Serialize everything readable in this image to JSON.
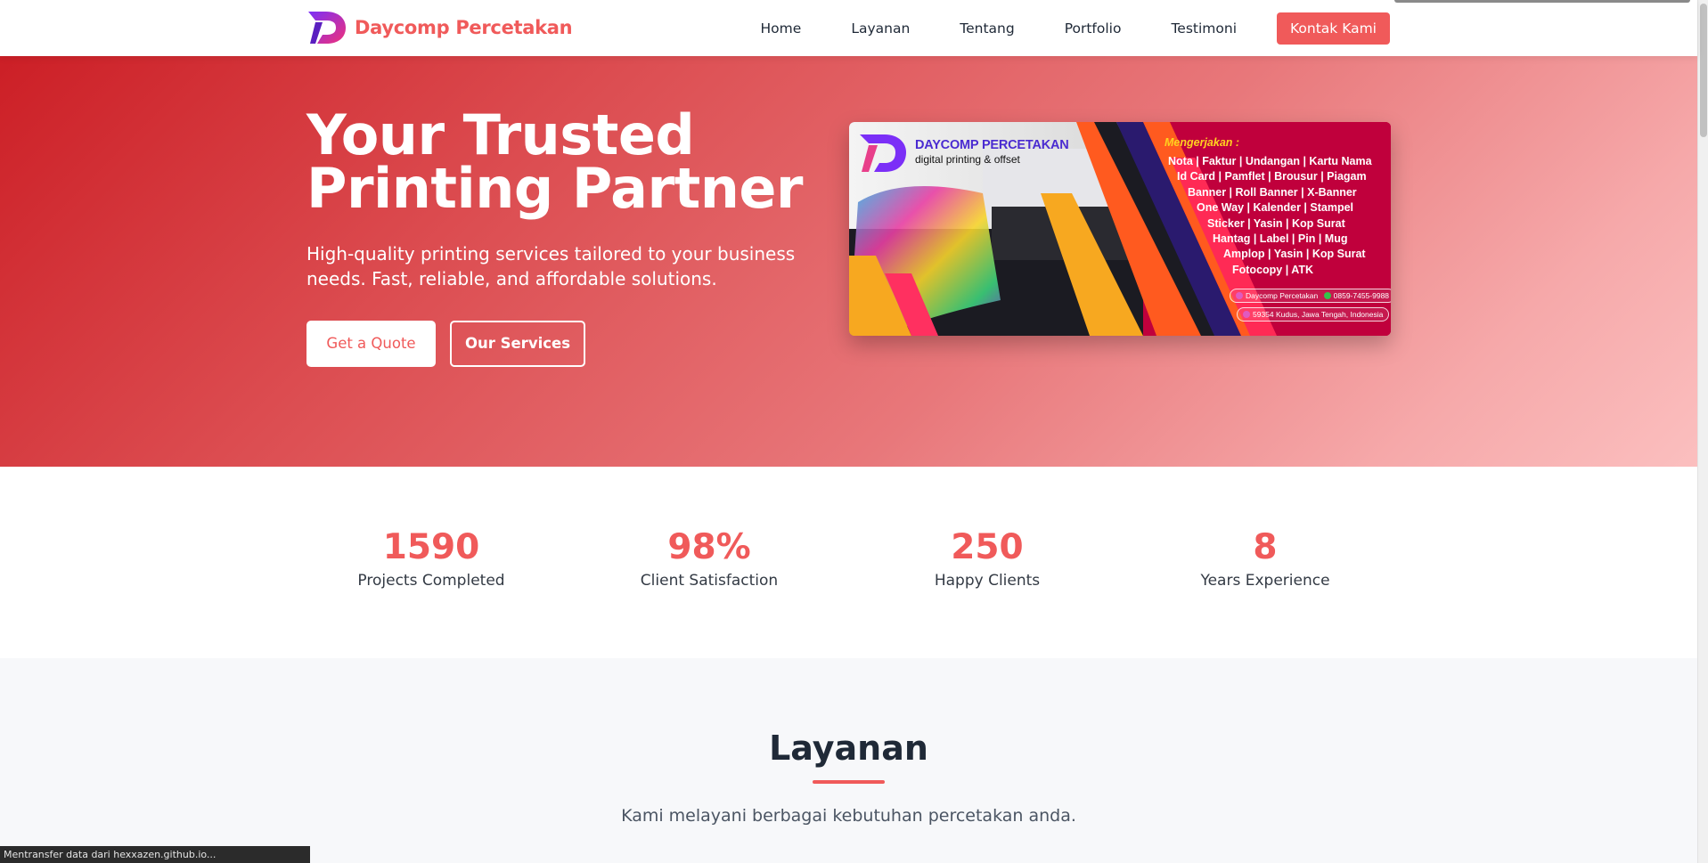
{
  "nav": {
    "brand": "Daycomp Percetakan",
    "links": [
      "Home",
      "Layanan",
      "Tentang",
      "Portfolio",
      "Testimoni"
    ],
    "cta": "Kontak Kami"
  },
  "hero": {
    "title_line1": "Your Trusted",
    "title_line2": "Printing Partner",
    "subtitle": "High-quality printing services tailored to your business needs. Fast, reliable, and affordable solutions.",
    "btn_quote": "Get a Quote",
    "btn_services": "Our Services"
  },
  "banner": {
    "brand": "DAYCOMP PERCETAKAN",
    "tagline": "digital printing & offset",
    "heading": "Mengerjakan :",
    "lines": [
      "Nota | Faktur | Undangan | Kartu Nama",
      "Id Card | Pamflet | Brousur | Piagam",
      "Banner | Roll Banner | X-Banner",
      "One Way | Kalender | Stampel",
      "Sticker | Yasin | Kop Surat",
      "Hantag | Label | Pin | Mug",
      "Amplop | Yasin | Kop Surat",
      "Fotocopy | ATK"
    ],
    "instagram": "Daycomp Percetakan",
    "whatsapp": "0859-7455-9988",
    "address": "59354 Kudus, Jawa Tengah, Indonesia"
  },
  "stats": [
    {
      "value": "1590",
      "label": "Projects Completed"
    },
    {
      "value": "98%",
      "label": "Client Satisfaction"
    },
    {
      "value": "250",
      "label": "Happy Clients"
    },
    {
      "value": "8",
      "label": "Years Experience"
    }
  ],
  "layanan": {
    "title": "Layanan",
    "subtitle": "Kami melayani berbagai kebutuhan percetakan anda."
  },
  "status_bar": "Mentransfer data dari hexxazen.github.io...",
  "colors": {
    "accent": "#f05a5a",
    "hero_start": "#cc1f26",
    "hero_end": "#fbbfbf",
    "banner_bg": "#c0003c"
  }
}
